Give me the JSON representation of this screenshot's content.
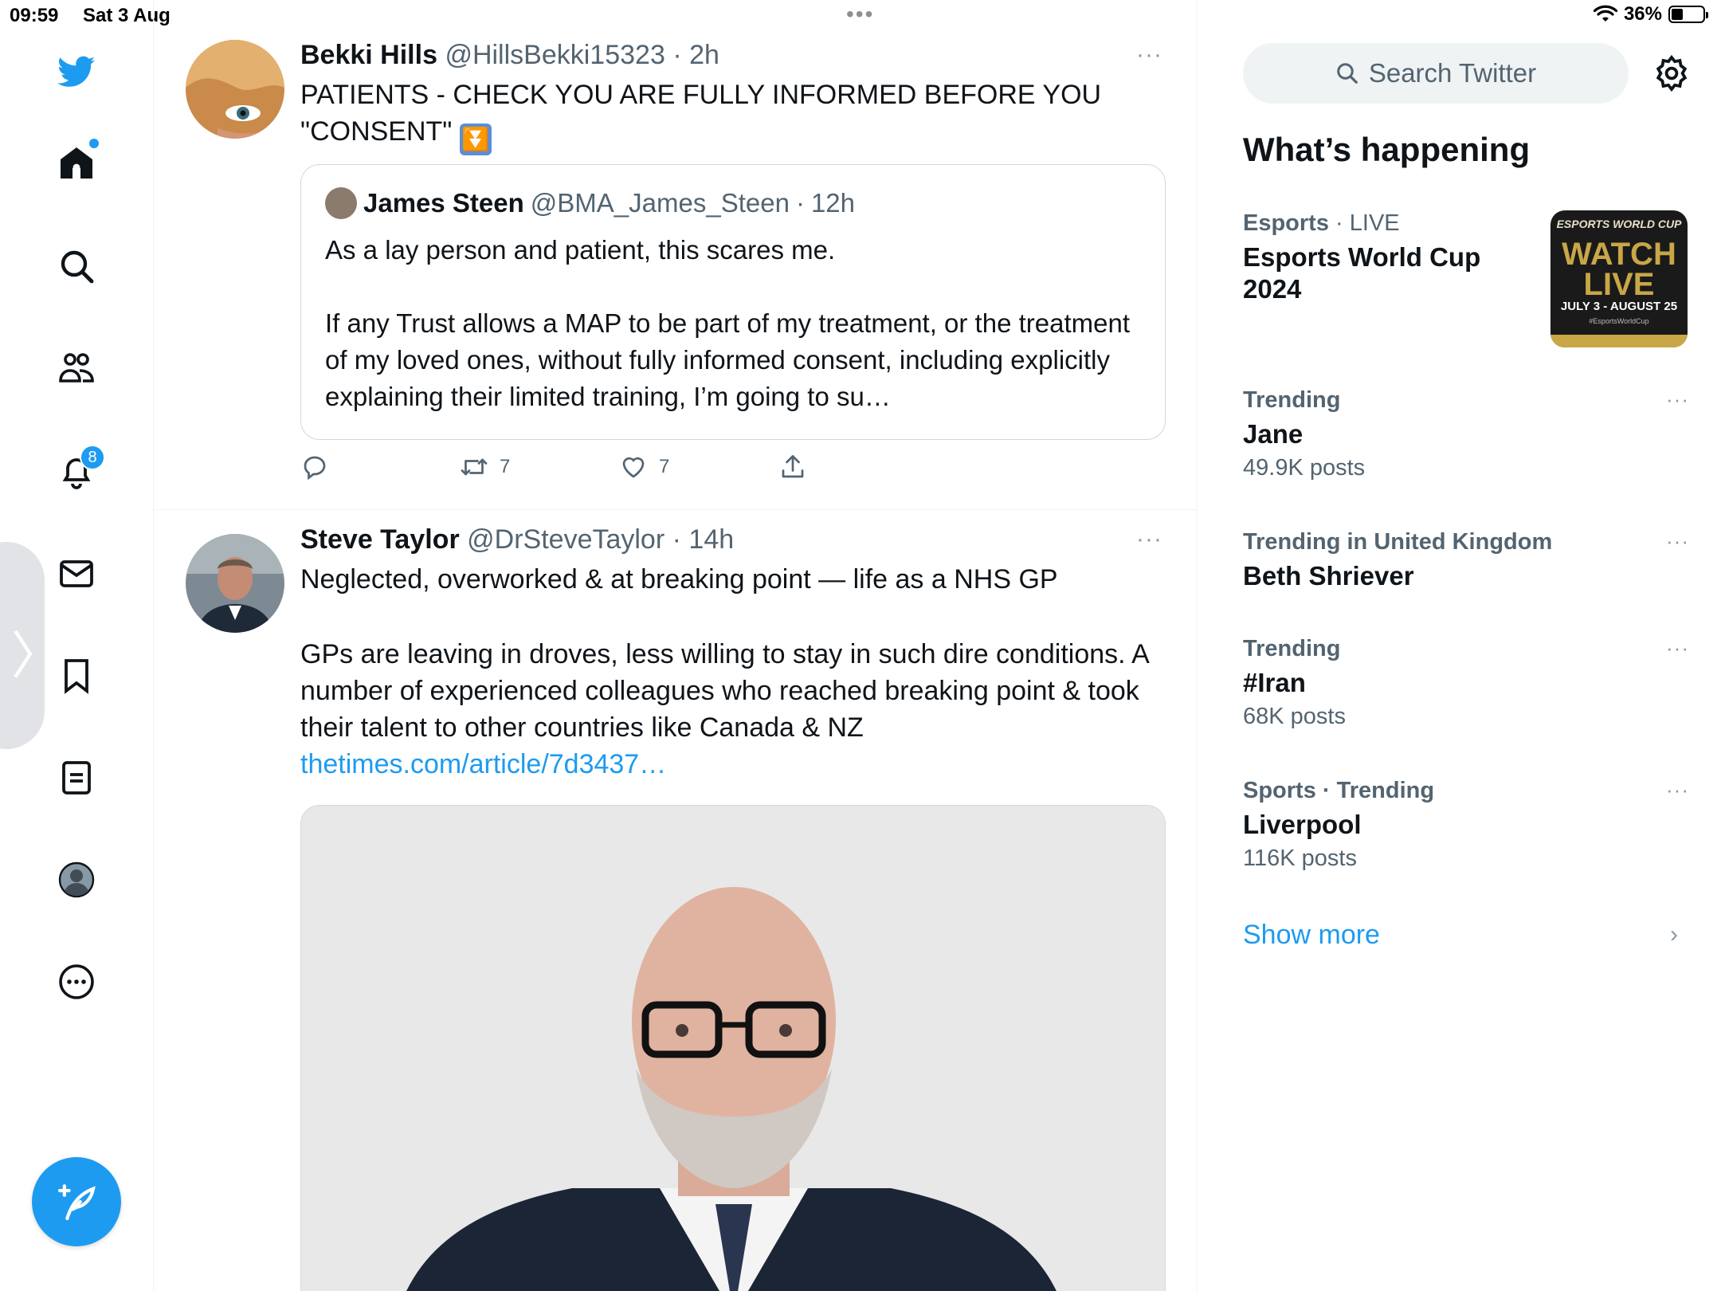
{
  "status_bar": {
    "time": "09:59",
    "date": "Sat 3 Aug",
    "battery": "36%",
    "battery_level": 0.36
  },
  "nav": {
    "icons": [
      "twitter-bird-icon",
      "home-icon",
      "search-icon",
      "communities-icon",
      "notifications-icon",
      "messages-icon",
      "bookmarks-icon",
      "lists-icon",
      "profile-icon",
      "more-icon"
    ],
    "notifications_badge": "8",
    "accent_color": "#1d9bf0"
  },
  "timeline": {
    "tweets": [
      {
        "name": "Bekki Hills",
        "handle": "@HillsBekki15323",
        "separator": "·",
        "time": "2h",
        "text_line1": "PATIENTS - CHECK YOU ARE FULLY INFORMED BEFORE YOU",
        "text_line2": "\"CONSENT\"",
        "emoji": "⏬",
        "quote": {
          "name": "James Steen",
          "handle": "@BMA_James_Steen",
          "separator": "·",
          "time": "12h",
          "text": "As a lay person and patient, this scares me.\n\nIf any Trust allows a MAP to be part of my treatment, or the treatment of my loved ones, without fully informed consent, including explicitly explaining their limited training, I’m going to su…"
        },
        "retweets": "7",
        "likes": "7"
      },
      {
        "name": "Steve Taylor",
        "handle": "@DrSteveTaylor",
        "separator": "·",
        "time": "14h",
        "text_para1": "Neglected, overworked & at breaking point — life as a NHS GP",
        "text_para2": "GPs are leaving in droves, less willing to stay in such dire conditions. A number of experienced colleagues who reached breaking point & took their talent to other countries like Canada & NZ ",
        "link": "thetimes.com/article/7d3437…"
      }
    ]
  },
  "sidebar": {
    "search_placeholder": "Search Twitter",
    "whats_happening": "What’s happening",
    "trends": [
      {
        "category_bold": "Esports",
        "category_rest": " · LIVE",
        "title": "Esports World Cup 2024",
        "count": ""
      },
      {
        "category_bold": "Trending",
        "category_rest": "",
        "title": "Jane",
        "count": "49.9K posts"
      },
      {
        "category_bold": "Trending in United Kingdom",
        "category_rest": "",
        "title": "Beth Shriever",
        "count": ""
      },
      {
        "category_bold": "Trending",
        "category_rest": "",
        "title": "#Iran",
        "count": "68K posts"
      },
      {
        "category_bold": "Sports · Trending",
        "category_rest": "",
        "title": "Liverpool",
        "count": "116K posts"
      }
    ],
    "thumb": {
      "line1": "ESPORTS WORLD CUP",
      "line2": "WATCH LIVE",
      "line3": "JULY 3 - AUGUST 25",
      "line4": "#EsportsWorldCup"
    },
    "more_dots": "···",
    "show_more": "Show more"
  }
}
